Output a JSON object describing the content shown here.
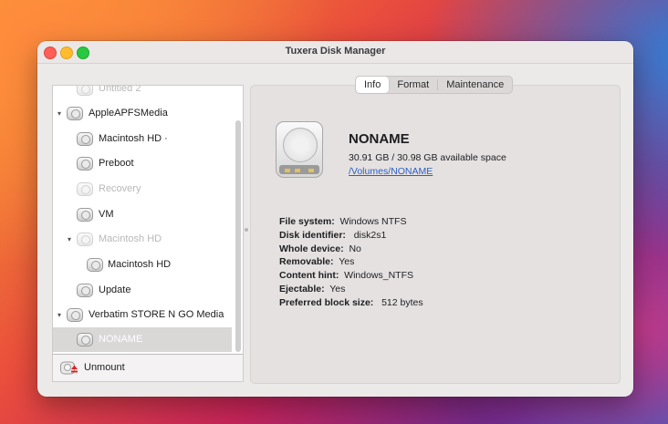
{
  "window": {
    "title": "Tuxera Disk Manager"
  },
  "sidebar": {
    "items": [
      {
        "label": "Untitled 2",
        "dim": true,
        "level": 1
      },
      {
        "label": "AppleAPFSMedia",
        "dim": false,
        "level": 0,
        "disclosure": "expanded"
      },
      {
        "label": "Macintosh HD ·",
        "dim": false,
        "level": 1
      },
      {
        "label": "Preboot",
        "dim": false,
        "level": 1
      },
      {
        "label": "Recovery",
        "dim": true,
        "level": 1
      },
      {
        "label": "VM",
        "dim": false,
        "level": 1
      },
      {
        "label": "Macintosh HD",
        "dim": true,
        "level": 1,
        "disclosure": "expanded"
      },
      {
        "label": "Macintosh HD",
        "dim": false,
        "level": 2
      },
      {
        "label": "Update",
        "dim": false,
        "level": 1
      },
      {
        "label": "Verbatim STORE N GO Media",
        "dim": false,
        "level": 0,
        "disclosure": "expanded"
      },
      {
        "label": "NONAME",
        "dim": false,
        "level": 1,
        "selected": true
      }
    ],
    "unmount_label": "Unmount"
  },
  "tabs": [
    {
      "label": "Info",
      "active": true
    },
    {
      "label": "Format",
      "active": false
    },
    {
      "label": "Maintenance",
      "active": false
    }
  ],
  "volume": {
    "name": "NONAME",
    "space": "30.91 GB / 30.98 GB available space",
    "path": "/Volumes/NONAME"
  },
  "info": [
    {
      "key": "File system:",
      "value": "Windows NTFS"
    },
    {
      "key": "Disk identifier:",
      "value": "disk2s1"
    },
    {
      "key": "Whole device:",
      "value": "No"
    },
    {
      "key": "Removable:",
      "value": "Yes"
    },
    {
      "key": "Content hint:",
      "value": "Windows_NTFS"
    },
    {
      "key": "Ejectable:",
      "value": "Yes"
    },
    {
      "key": "Preferred block size:",
      "value": "512 bytes"
    }
  ],
  "colors": {
    "link": "#2a5fc7",
    "selection": "#dad7d7",
    "close": "#fe5f57",
    "minimize": "#febc2e",
    "maximize": "#28c840"
  }
}
